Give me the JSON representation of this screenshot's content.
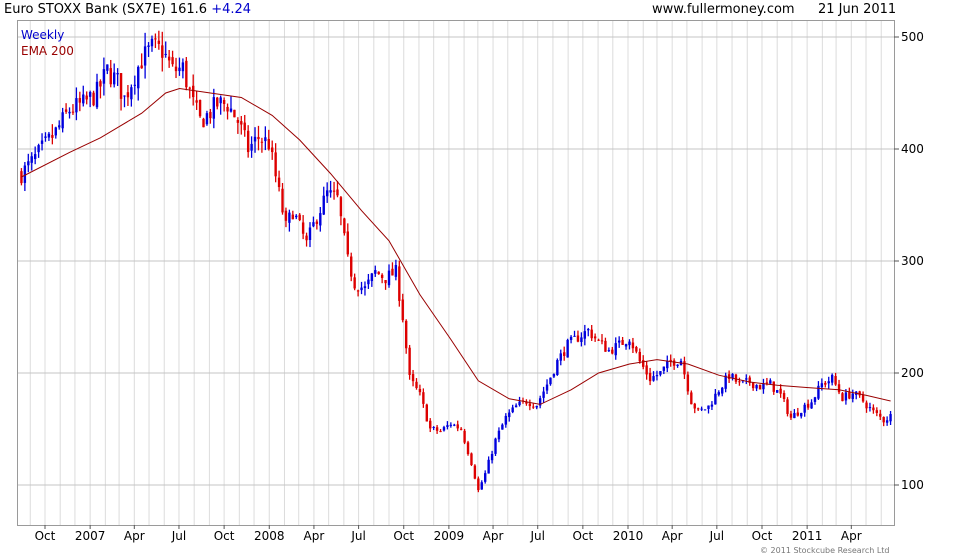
{
  "header": {
    "instrument": "Euro STOXX Bank (SX7E)",
    "last": "161.6",
    "change": "+4.24",
    "site": "www.fullermoney.com",
    "date": "21 Jun 2011"
  },
  "footer": {
    "copyright": "© 2011 Stockcube Research Ltd"
  },
  "colors": {
    "up": "#0000dd",
    "down": "#dd0000",
    "ema": "#990000",
    "grid": "#dcdcdc",
    "weekly_label": "#0000cc",
    "ema_label": "#990000"
  },
  "chart_data": {
    "type": "candlestick",
    "title": "Euro STOXX Bank (SX7E)",
    "legend": [
      "Weekly",
      "EMA 200"
    ],
    "legend_position": "top-left",
    "grid": true,
    "y_axis_side": "right",
    "ylim": [
      60,
      510
    ],
    "y_ticks": [
      100,
      200,
      300,
      400,
      500
    ],
    "x_ticks": [
      "Oct",
      "2007",
      "Apr",
      "Jul",
      "Oct",
      "2008",
      "Apr",
      "Jul",
      "Oct",
      "2009",
      "Apr",
      "Jul",
      "Oct",
      "2010",
      "Apr",
      "Jul",
      "Oct",
      "2011",
      "Apr"
    ],
    "price_path": [
      [
        "2006-08-14",
        378
      ],
      [
        "2006-09-04",
        388
      ],
      [
        "2006-09-25",
        400
      ],
      [
        "2006-10-23",
        415
      ],
      [
        "2006-11-20",
        435
      ],
      [
        "2006-12-18",
        440
      ],
      [
        "2007-01-15",
        450
      ],
      [
        "2007-02-05",
        470
      ],
      [
        "2007-02-26",
        460
      ],
      [
        "2007-03-12",
        445
      ],
      [
        "2007-03-26",
        460
      ],
      [
        "2007-04-16",
        480
      ],
      [
        "2007-05-07",
        490
      ],
      [
        "2007-05-28",
        488
      ],
      [
        "2007-06-18",
        470
      ],
      [
        "2007-07-09",
        472
      ],
      [
        "2007-07-30",
        440
      ],
      [
        "2007-08-13",
        425
      ],
      [
        "2007-08-27",
        430
      ],
      [
        "2007-09-17",
        440
      ],
      [
        "2007-10-08",
        440
      ],
      [
        "2007-10-29",
        425
      ],
      [
        "2007-11-19",
        400
      ],
      [
        "2007-12-10",
        410
      ],
      [
        "2007-12-31",
        405
      ],
      [
        "2008-01-21",
        360
      ],
      [
        "2008-02-04",
        330
      ],
      [
        "2008-02-18",
        345
      ],
      [
        "2008-03-17",
        315
      ],
      [
        "2008-04-07",
        340
      ],
      [
        "2008-04-28",
        360
      ],
      [
        "2008-05-19",
        355
      ],
      [
        "2008-06-09",
        300
      ],
      [
        "2008-06-23",
        280
      ],
      [
        "2008-07-14",
        275
      ],
      [
        "2008-08-04",
        290
      ],
      [
        "2008-08-25",
        285
      ],
      [
        "2008-09-15",
        290
      ],
      [
        "2008-09-29",
        250
      ],
      [
        "2008-10-13",
        195
      ],
      [
        "2008-11-03",
        180
      ],
      [
        "2008-11-24",
        150
      ],
      [
        "2008-12-15",
        148
      ],
      [
        "2009-01-05",
        155
      ],
      [
        "2009-01-26",
        150
      ],
      [
        "2009-02-16",
        120
      ],
      [
        "2009-03-02",
        95
      ],
      [
        "2009-03-16",
        110
      ],
      [
        "2009-04-06",
        140
      ],
      [
        "2009-04-27",
        160
      ],
      [
        "2009-05-18",
        170
      ],
      [
        "2009-06-08",
        175
      ],
      [
        "2009-06-29",
        172
      ],
      [
        "2009-07-20",
        190
      ],
      [
        "2009-08-10",
        210
      ],
      [
        "2009-08-31",
        225
      ],
      [
        "2009-09-21",
        232
      ],
      [
        "2009-10-12",
        238
      ],
      [
        "2009-11-02",
        228
      ],
      [
        "2009-11-23",
        220
      ],
      [
        "2009-12-14",
        225
      ],
      [
        "2010-01-04",
        232
      ],
      [
        "2010-01-25",
        210
      ],
      [
        "2010-02-15",
        195
      ],
      [
        "2010-03-08",
        200
      ],
      [
        "2010-03-29",
        210
      ],
      [
        "2010-04-19",
        212
      ],
      [
        "2010-05-10",
        175
      ],
      [
        "2010-05-24",
        165
      ],
      [
        "2010-06-14",
        170
      ],
      [
        "2010-07-05",
        185
      ],
      [
        "2010-07-26",
        198
      ],
      [
        "2010-08-16",
        190
      ],
      [
        "2010-09-06",
        192
      ],
      [
        "2010-09-27",
        188
      ],
      [
        "2010-10-18",
        190
      ],
      [
        "2010-11-08",
        180
      ],
      [
        "2010-11-29",
        160
      ],
      [
        "2010-12-20",
        168
      ],
      [
        "2011-01-10",
        175
      ],
      [
        "2011-01-31",
        190
      ],
      [
        "2011-02-21",
        195
      ],
      [
        "2011-03-14",
        178
      ],
      [
        "2011-04-04",
        182
      ],
      [
        "2011-04-25",
        175
      ],
      [
        "2011-05-16",
        165
      ],
      [
        "2011-06-06",
        158
      ],
      [
        "2011-06-20",
        161.6
      ]
    ],
    "ema_path": [
      [
        "2006-08-14",
        375
      ],
      [
        "2006-11-20",
        397
      ],
      [
        "2007-01-22",
        410
      ],
      [
        "2007-04-16",
        432
      ],
      [
        "2007-06-04",
        450
      ],
      [
        "2007-07-02",
        454
      ],
      [
        "2007-09-03",
        450
      ],
      [
        "2007-11-05",
        446
      ],
      [
        "2008-01-07",
        430
      ],
      [
        "2008-03-03",
        408
      ],
      [
        "2008-05-05",
        378
      ],
      [
        "2008-07-07",
        345
      ],
      [
        "2008-09-01",
        318
      ],
      [
        "2008-11-03",
        270
      ],
      [
        "2009-01-05",
        230
      ],
      [
        "2009-03-02",
        193
      ],
      [
        "2009-05-04",
        177
      ],
      [
        "2009-07-06",
        172
      ],
      [
        "2009-09-07",
        185
      ],
      [
        "2009-11-02",
        200
      ],
      [
        "2010-01-04",
        208
      ],
      [
        "2010-03-01",
        212
      ],
      [
        "2010-05-03",
        208
      ],
      [
        "2010-07-05",
        198
      ],
      [
        "2010-09-06",
        192
      ],
      [
        "2010-11-01",
        189
      ],
      [
        "2011-01-03",
        187
      ],
      [
        "2011-03-07",
        185
      ],
      [
        "2011-05-02",
        180
      ],
      [
        "2011-06-20",
        175
      ]
    ]
  }
}
